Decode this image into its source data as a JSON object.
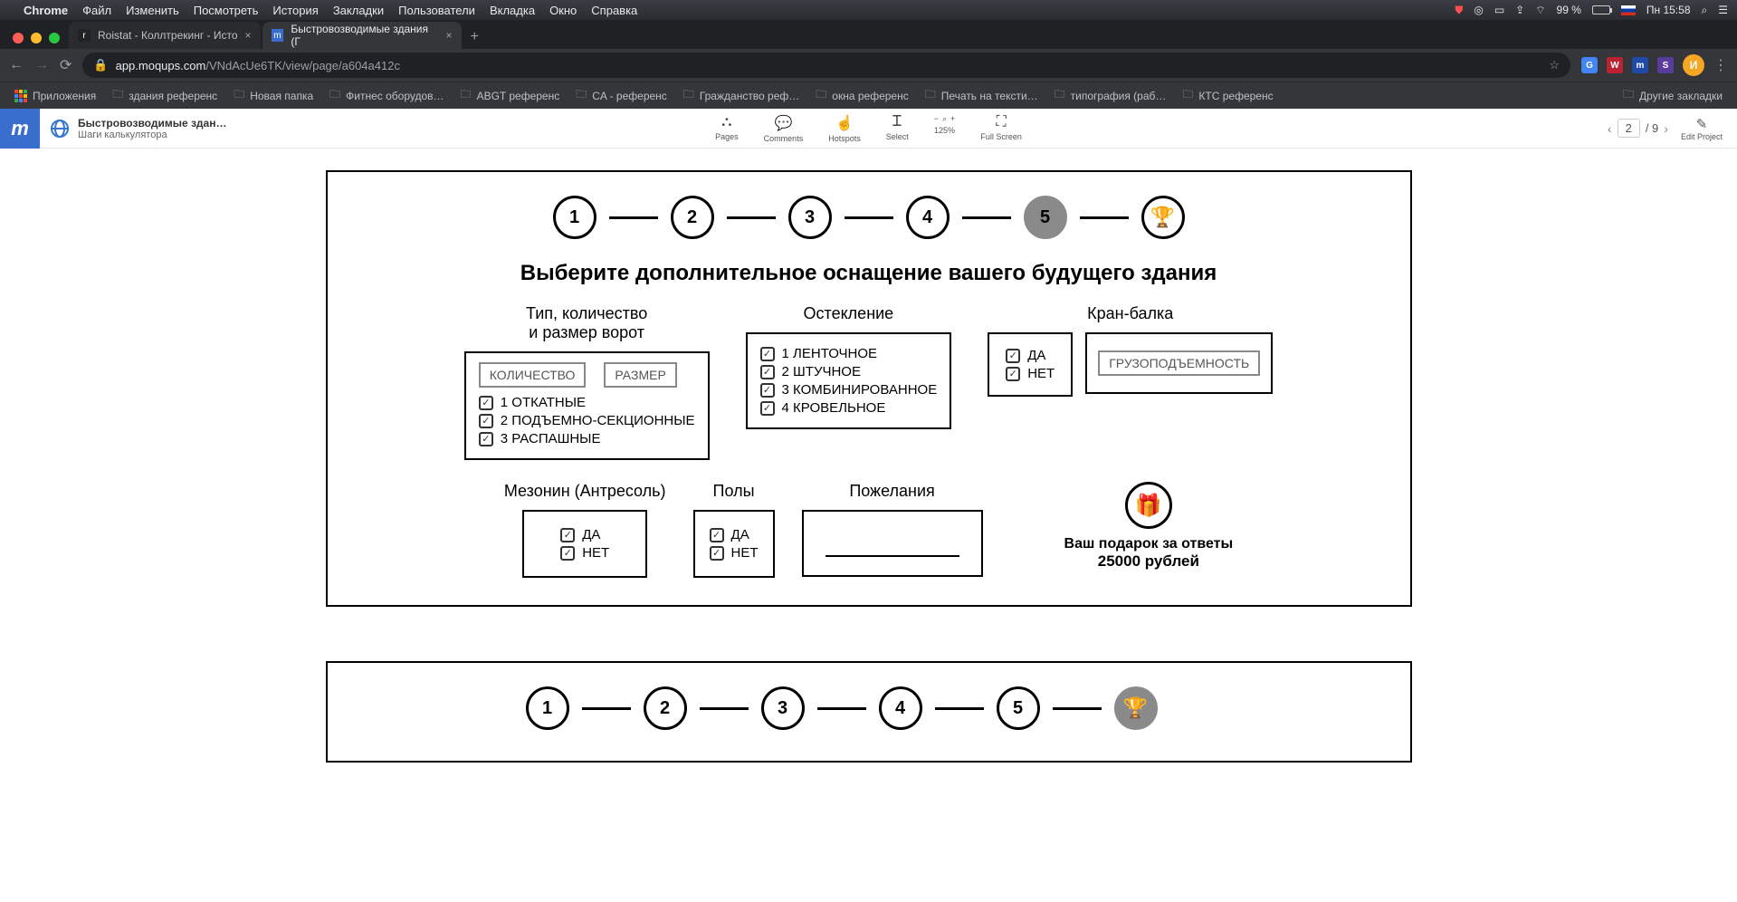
{
  "mac_menu": {
    "app": "Chrome",
    "items": [
      "Файл",
      "Изменить",
      "Посмотреть",
      "История",
      "Закладки",
      "Пользователи",
      "Вкладка",
      "Окно",
      "Справка"
    ],
    "battery": "99 %",
    "time": "Пн 15:58"
  },
  "tabs": {
    "inactive": {
      "favicon": "r",
      "title": "Roistat - Коллтрекинг - Исто"
    },
    "active": {
      "favicon": "m",
      "title": "Быстровозводимые здания (Г"
    }
  },
  "url": {
    "domain": "app.moqups.com",
    "path": "/VNdAcUe6TK/view/page/a604a412c"
  },
  "avatar_letter": "И",
  "bookmarks": {
    "apps_label": "Приложения",
    "items": [
      "здания референс",
      "Новая папка",
      "Фитнес оборудов…",
      "ABGT референс",
      "CA - референс",
      "Гражданство реф…",
      "окна референс",
      "Печать на тексти…",
      "типография (раб…",
      "КТС референс"
    ],
    "other": "Другие закладки"
  },
  "moqups": {
    "project_title": "Быстровозводимые здан…",
    "breadcrumb": "Шаги калькулятора",
    "tools": {
      "pages": "Pages",
      "comments": "Comments",
      "hotspots": "Hotspots",
      "select": "Select",
      "zoom": "125%",
      "fullscreen": "Full Screen"
    },
    "pager": {
      "current": "2",
      "total": "/ 9"
    },
    "edit": "Edit Project"
  },
  "frame1": {
    "steps": [
      "1",
      "2",
      "3",
      "4",
      "5"
    ],
    "active_step": 5,
    "title": "Выберите  дополнительное оснащение вашего будущего здания",
    "gates": {
      "label": "Тип, количество\nи размер ворот",
      "input1": "КОЛИЧЕСТВО",
      "input2": "РАЗМЕР",
      "opts": [
        "1 ОТКАТНЫЕ",
        "2 ПОДЪЕМНО-СЕКЦИОННЫЕ",
        "3 РАСПАШНЫЕ"
      ]
    },
    "glazing": {
      "label": "Остекление",
      "opts": [
        "1 ЛЕНТОЧНОЕ",
        "2 ШТУЧНОЕ",
        "3 КОМБИНИРОВАННОЕ",
        "4 КРОВЕЛЬНОЕ"
      ]
    },
    "crane": {
      "label": "Кран-балка",
      "yes": "ДА",
      "no": "НЕТ",
      "capacity": "ГРУЗОПОДЪЕМНОСТЬ"
    },
    "mezz": {
      "label": "Мезонин (Антресоль)",
      "yes": "ДА",
      "no": "НЕТ"
    },
    "floors": {
      "label": "Полы",
      "yes": "ДА",
      "no": "НЕТ"
    },
    "wishes": {
      "label": "Пожелания"
    },
    "gift": {
      "line1": "Ваш подарок за ответы",
      "line2": "25000 рублей"
    }
  },
  "frame2": {
    "steps": [
      "1",
      "2",
      "3",
      "4",
      "5"
    ],
    "active_step": 6
  }
}
